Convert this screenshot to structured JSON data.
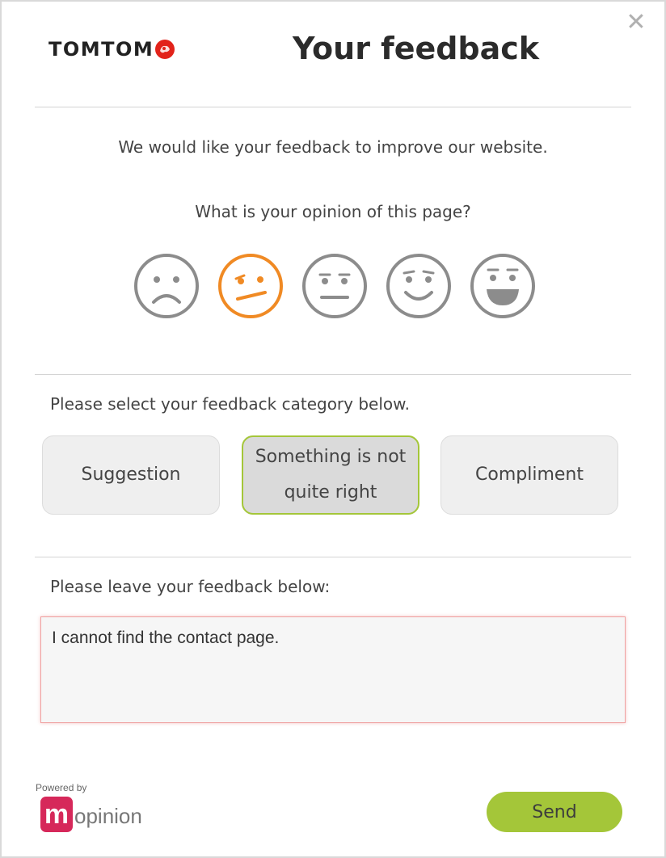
{
  "header": {
    "brand_text": "TOMTOM",
    "brand_icon": "tomtom-hands-logo",
    "title": "Your feedback",
    "close_icon": "close-icon"
  },
  "intro": {
    "message": "We would like your feedback to improve our website.",
    "question": "What is your opinion of this page?"
  },
  "rating": {
    "options": [
      "very-sad-face-icon",
      "sad-face-icon",
      "neutral-face-icon",
      "happy-face-icon",
      "very-happy-face-icon"
    ],
    "selected_index": 1,
    "selected_color": "#f08a24",
    "default_color": "#8c8c8c"
  },
  "category": {
    "label": "Please select your feedback category below.",
    "options": [
      {
        "label": "Suggestion",
        "selected": false
      },
      {
        "label": "Something is not quite right",
        "selected": true
      },
      {
        "label": "Compliment",
        "selected": false
      }
    ],
    "selected_border_color": "#a4c639"
  },
  "feedback": {
    "label": "Please leave your feedback below:",
    "value": "I cannot find the contact page."
  },
  "footer": {
    "powered_by": "Powered by",
    "brand_letter": "m",
    "brand_text": "opinion",
    "send_label": "Send",
    "send_color": "#a4c639"
  }
}
